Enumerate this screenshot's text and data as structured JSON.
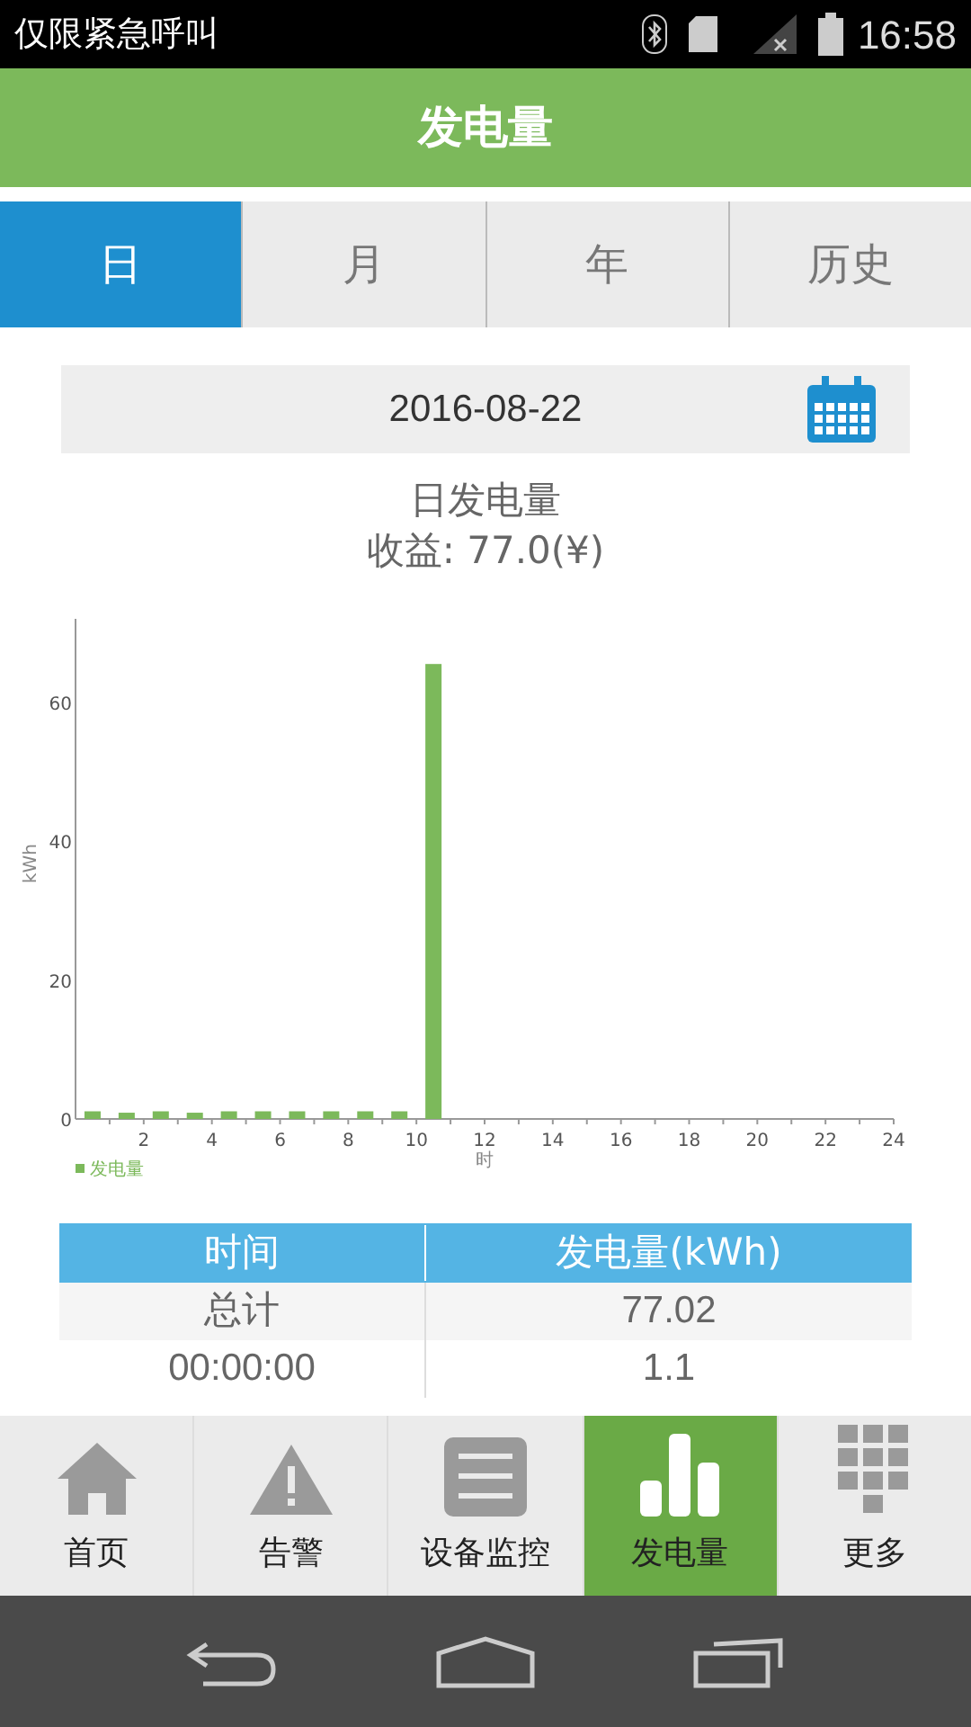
{
  "status_bar": {
    "carrier": "仅限紧急呼叫",
    "time": "16:58"
  },
  "header": {
    "title": "发电量"
  },
  "tabs": [
    {
      "label": "日",
      "selected": true
    },
    {
      "label": "月",
      "selected": false
    },
    {
      "label": "年",
      "selected": false
    },
    {
      "label": "历史",
      "selected": false
    }
  ],
  "date_field": {
    "value": "2016-08-22"
  },
  "summary": {
    "title": "日发电量",
    "income": "收益: 77.0(¥)"
  },
  "chart": {
    "chart_data": {
      "type": "bar",
      "xlabel": "时",
      "ylabel": "kWh",
      "x": [
        0.5,
        1.5,
        2.5,
        3.5,
        4.5,
        5.5,
        6.5,
        7.5,
        8.5,
        9.5,
        10.5
      ],
      "series": [
        {
          "name": "发电量",
          "color": "#7cb95b",
          "values": [
            1.1,
            0.9,
            1.1,
            0.9,
            1.1,
            1.1,
            1.1,
            1.1,
            1.1,
            1.1,
            65.5
          ]
        }
      ],
      "xlim": [
        0,
        24
      ],
      "ylim": [
        0,
        72
      ],
      "xticks": [
        2,
        4,
        6,
        8,
        10,
        12,
        14,
        16,
        18,
        20,
        22,
        24
      ],
      "yticks": [
        0,
        20,
        40,
        60
      ]
    }
  },
  "table": {
    "columns": [
      "时间",
      "发电量(kWh)"
    ],
    "rows": [
      [
        "总计",
        "77.02"
      ],
      [
        "00:00:00",
        "1.1"
      ]
    ]
  },
  "bottom_nav": [
    {
      "label": "首页",
      "kind": "home",
      "selected": false
    },
    {
      "label": "告警",
      "kind": "alarm",
      "selected": false
    },
    {
      "label": "设备监控",
      "kind": "monitor",
      "selected": false
    },
    {
      "label": "发电量",
      "kind": "power",
      "selected": true
    },
    {
      "label": "更多",
      "kind": "more",
      "selected": false
    }
  ]
}
